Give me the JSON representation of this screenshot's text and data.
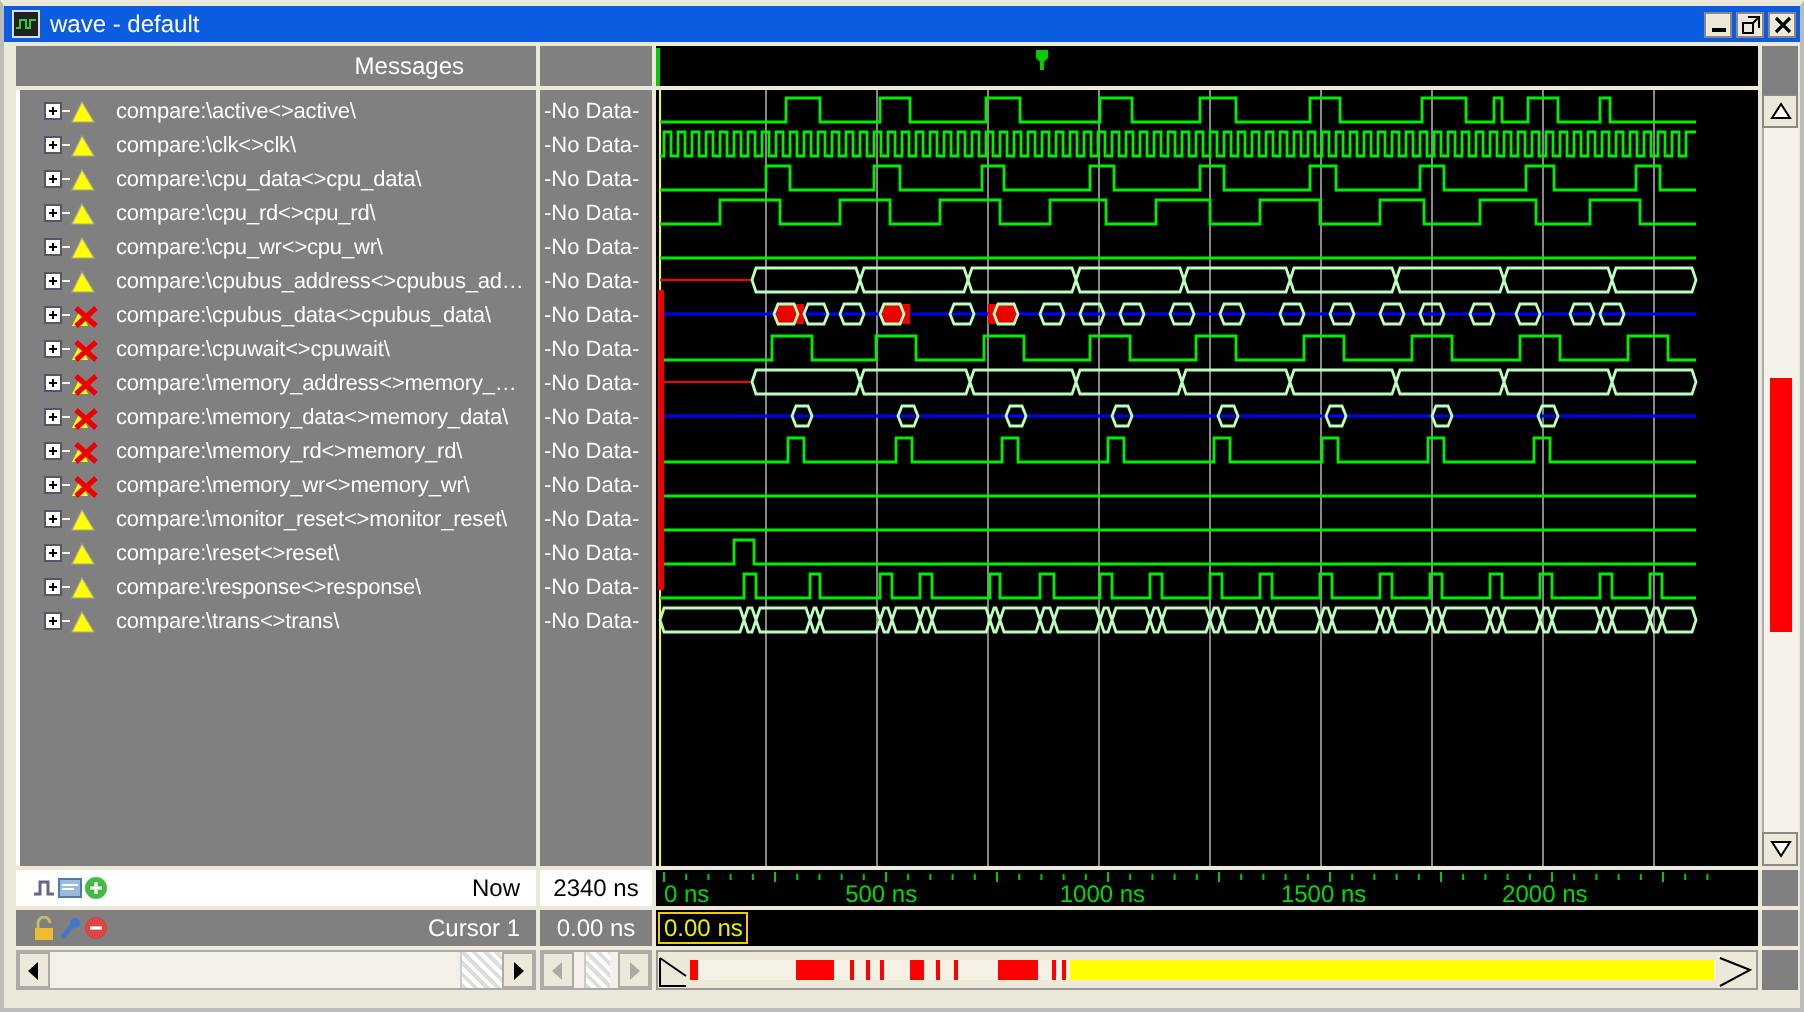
{
  "window": {
    "title": "wave - default"
  },
  "header": {
    "label": "Messages"
  },
  "signals": [
    {
      "name": "compare:\\active<>active\\",
      "value": "-No Data-",
      "mismatch": false
    },
    {
      "name": "compare:\\clk<>clk\\",
      "value": "-No Data-",
      "mismatch": false
    },
    {
      "name": "compare:\\cpu_data<>cpu_data\\",
      "value": "-No Data-",
      "mismatch": false
    },
    {
      "name": "compare:\\cpu_rd<>cpu_rd\\",
      "value": "-No Data-",
      "mismatch": false
    },
    {
      "name": "compare:\\cpu_wr<>cpu_wr\\",
      "value": "-No Data-",
      "mismatch": false
    },
    {
      "name": "compare:\\cpubus_address<>cpubus_ad…",
      "value": "-No Data-",
      "mismatch": false
    },
    {
      "name": "compare:\\cpubus_data<>cpubus_data\\",
      "value": "-No Data-",
      "mismatch": true
    },
    {
      "name": "compare:\\cpuwait<>cpuwait\\",
      "value": "-No Data-",
      "mismatch": true
    },
    {
      "name": "compare:\\memory_address<>memory_…",
      "value": "-No Data-",
      "mismatch": true
    },
    {
      "name": "compare:\\memory_data<>memory_data\\",
      "value": "-No Data-",
      "mismatch": true
    },
    {
      "name": "compare:\\memory_rd<>memory_rd\\",
      "value": "-No Data-",
      "mismatch": true
    },
    {
      "name": "compare:\\memory_wr<>memory_wr\\",
      "value": "-No Data-",
      "mismatch": true
    },
    {
      "name": "compare:\\monitor_reset<>monitor_reset\\",
      "value": "-No Data-",
      "mismatch": false
    },
    {
      "name": "compare:\\reset<>reset\\",
      "value": "-No Data-",
      "mismatch": false
    },
    {
      "name": "compare:\\response<>response\\",
      "value": "-No Data-",
      "mismatch": false
    },
    {
      "name": "compare:\\trans<>trans\\",
      "value": "-No Data-",
      "mismatch": false
    }
  ],
  "now": {
    "label": "Now",
    "value": "2340 ns"
  },
  "cursor": {
    "label": "Cursor 1",
    "value": "0.00 ns",
    "marker": "0.00 ns"
  },
  "timeline": {
    "labels": [
      "0 ns",
      "500 ns",
      "1000 ns",
      "1500 ns",
      "2000 ns"
    ]
  }
}
